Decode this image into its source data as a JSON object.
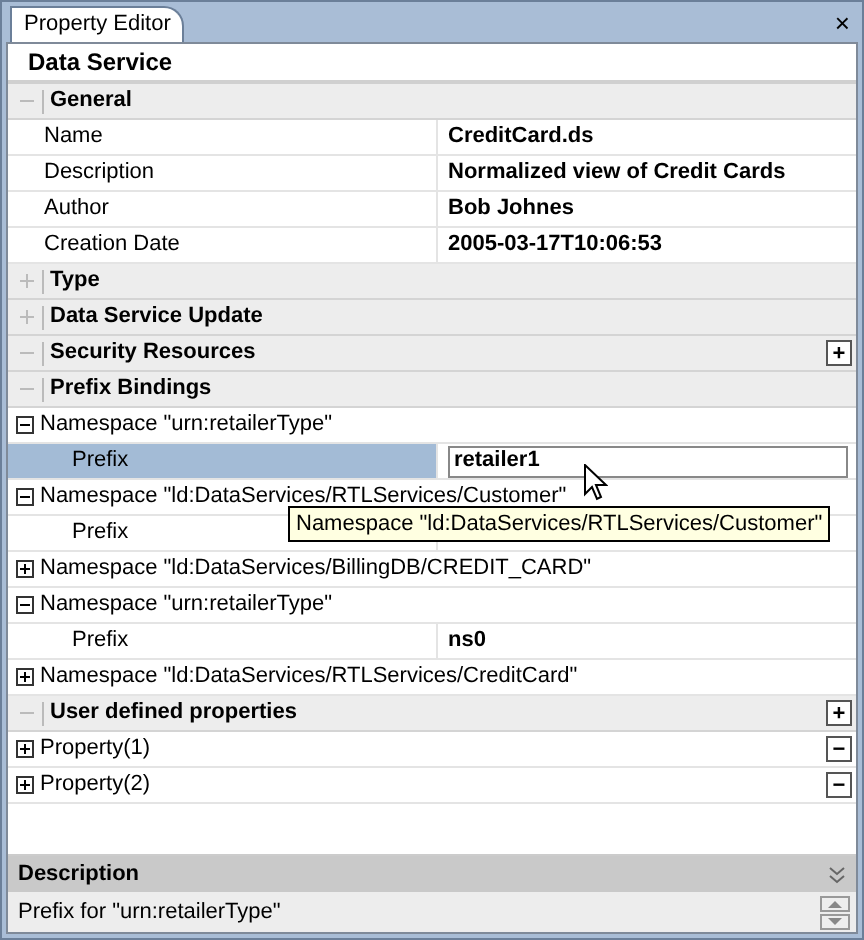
{
  "tab": {
    "label": "Property Editor",
    "selected": true
  },
  "close": "×",
  "header": "Data Service",
  "sections": [
    {
      "title": "General",
      "expanded": true,
      "children": [
        {
          "kind": "property",
          "label": "Name",
          "value": "CreditCard.ds",
          "selected": false
        },
        {
          "kind": "property",
          "label": "Description",
          "value": "Normalized view of Credit Cards",
          "selected": false
        },
        {
          "kind": "property",
          "label": "Author",
          "value": "Bob Johnes",
          "selected": false
        },
        {
          "kind": "property",
          "label": "Creation Date",
          "value": "2005-03-17T10:06:53",
          "selected": false
        }
      ]
    },
    {
      "title": "Type",
      "expanded": false
    },
    {
      "title": "Data Service Update",
      "expanded": false
    },
    {
      "title": "Security Resources",
      "expanded": true,
      "button": "+"
    },
    {
      "title": "Prefix Bindings",
      "expanded": true,
      "children": [
        {
          "kind": "namespace",
          "label": "Namespace \"urn:retailerType\"",
          "expanded": true,
          "children": [
            {
              "kind": "property",
              "label": "Prefix",
              "value": "retailer1",
              "selected": true
            }
          ]
        },
        {
          "kind": "namespace",
          "label": "Namespace \"ld:DataServices/RTLServices/Customer\"",
          "expanded": true,
          "children": [
            {
              "kind": "property",
              "label": "Prefix",
              "selected": false
            }
          ]
        },
        {
          "kind": "namespace",
          "label": "Namespace \"ld:DataServices/BillingDB/CREDIT_CARD\"",
          "expanded": false
        },
        {
          "kind": "namespace",
          "label": "Namespace \"urn:retailerType\"",
          "expanded": true,
          "children": [
            {
              "kind": "property",
              "label": "Prefix",
              "value": "ns0",
              "selected": false
            }
          ]
        },
        {
          "kind": "namespace",
          "label": "Namespace \"ld:DataServices/RTLServices/CreditCard\"",
          "expanded": false
        }
      ]
    },
    {
      "title": "User defined properties",
      "expanded": true,
      "button": "+",
      "children": [
        {
          "kind": "namespace",
          "label": "Property(1)",
          "expanded": false,
          "button": "−"
        },
        {
          "kind": "namespace",
          "label": "Property(2)",
          "expanded": false,
          "button": "−"
        }
      ]
    }
  ],
  "tooltip": "Namespace \"ld:DataServices/RTLServices/Customer\"",
  "description": {
    "title": "Description",
    "text": "Prefix for \"urn:retailerType\""
  }
}
